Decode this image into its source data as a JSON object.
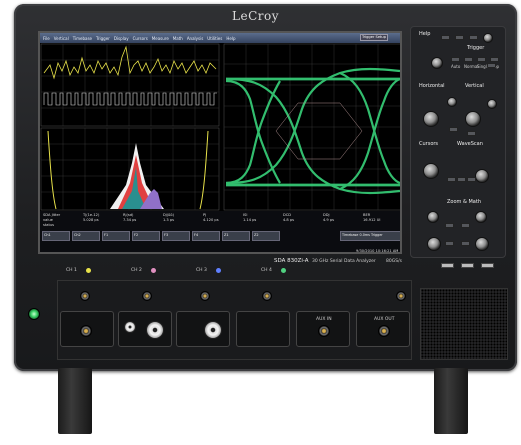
{
  "brand": "LeCroy",
  "menu": [
    "File",
    "Vertical",
    "Timebase",
    "Trigger",
    "Display",
    "Cursors",
    "Measure",
    "Math",
    "Analysis",
    "Utilities",
    "Help"
  ],
  "menu_right": "Trigger Setup",
  "meas_headers": [
    "SDA Jitter",
    "Tj(1e-12)",
    "Rj(sd)",
    "Dj(δδ)",
    "PJ",
    "ISI",
    "DCD",
    "DDj",
    "BER"
  ],
  "meas_values": [
    "value",
    "status"
  ],
  "meas_sub": [
    "5.028 ps",
    "7.34 ps",
    "1.3 ps",
    "4.120 ps",
    "1.14 ps",
    "4.8 ps",
    "4.9 ps",
    "16.912 UI"
  ],
  "chips": [
    "Ch1",
    "Ch2",
    "F1",
    "F2",
    "F3",
    "F4",
    "Z1",
    "Z2"
  ],
  "timebase": "Timebase 0.0ms  Trigger",
  "timestamp": "9/30/2010 10:16:21 AM",
  "model": "SDA 830Zi-A",
  "model_sub": "30 GHz Serial Data Analyzer",
  "rate": "80GS/s",
  "channels": [
    "CH 1",
    "CH 2",
    "CH 3",
    "CH 4"
  ],
  "panel": {
    "trigger": "Trigger",
    "horizontal": "Horizontal",
    "vertical": "Vertical",
    "cursors": "Cursors",
    "wavescan": "WaveScan",
    "zoom_math": "Zoom & Math",
    "help": "Help",
    "modes": [
      "Auto",
      "Normal",
      "Single",
      "Stop"
    ]
  },
  "io_labels": [
    "AUX IN",
    "AUX OUT"
  ],
  "colors": {
    "yellow": "#e8e24a",
    "eye_green": "#38d27a",
    "hist_red": "#e04040",
    "hist_teal": "#2a8f8f",
    "hist_white": "#f0f0f0"
  }
}
